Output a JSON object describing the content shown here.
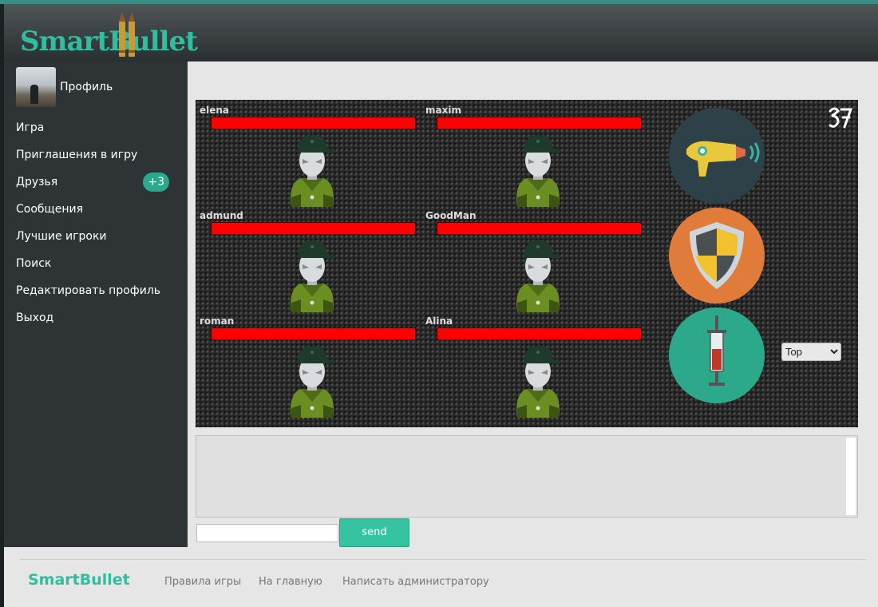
{
  "header": {
    "logo": "SmartBullet"
  },
  "sidebar": {
    "profile_label": "Профиль",
    "items": [
      {
        "label": "Игра"
      },
      {
        "label": "Приглашения в игру"
      },
      {
        "label": "Друзья",
        "badge": "+3"
      },
      {
        "label": "Сообщения"
      },
      {
        "label": "Лучшие игроки"
      },
      {
        "label": "Поиск"
      },
      {
        "label": "Редактировать профиль"
      },
      {
        "label": "Выход"
      }
    ]
  },
  "game": {
    "players": [
      {
        "name": "elena",
        "hp_fraction": 1.0
      },
      {
        "name": "maxim",
        "hp_fraction": 1.0
      },
      {
        "name": "admund",
        "hp_fraction": 1.0
      },
      {
        "name": "GoodMan",
        "hp_fraction": 1.0
      },
      {
        "name": "roman",
        "hp_fraction": 1.0
      },
      {
        "name": "Alina",
        "hp_fraction": 1.0
      }
    ],
    "powerups": [
      "ray-gun-icon",
      "shield-icon",
      "syringe-icon"
    ],
    "target_select": {
      "selected": "Top"
    }
  },
  "chat": {
    "input_value": "",
    "send_label": "send"
  },
  "footer": {
    "brand": "SmartBullet",
    "links": [
      "Правила игры",
      "На главную",
      "Написать администратору"
    ]
  },
  "colors": {
    "accent": "#2fbe9e",
    "hp": "#ff0000",
    "sidebar": "#2e3436"
  }
}
